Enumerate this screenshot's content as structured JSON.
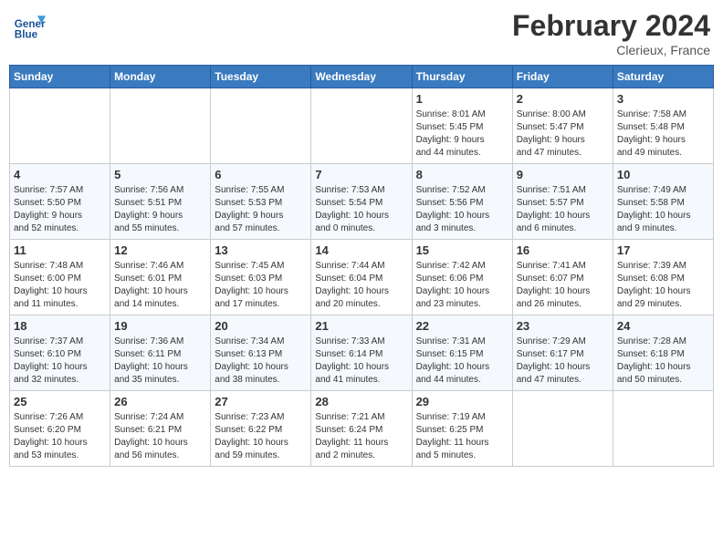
{
  "header": {
    "logo_line1": "General",
    "logo_line2": "Blue",
    "month_title": "February 2024",
    "location": "Clerieux, France"
  },
  "calendar": {
    "days_of_week": [
      "Sunday",
      "Monday",
      "Tuesday",
      "Wednesday",
      "Thursday",
      "Friday",
      "Saturday"
    ],
    "weeks": [
      [
        {
          "day": "",
          "info": ""
        },
        {
          "day": "",
          "info": ""
        },
        {
          "day": "",
          "info": ""
        },
        {
          "day": "",
          "info": ""
        },
        {
          "day": "1",
          "info": "Sunrise: 8:01 AM\nSunset: 5:45 PM\nDaylight: 9 hours\nand 44 minutes."
        },
        {
          "day": "2",
          "info": "Sunrise: 8:00 AM\nSunset: 5:47 PM\nDaylight: 9 hours\nand 47 minutes."
        },
        {
          "day": "3",
          "info": "Sunrise: 7:58 AM\nSunset: 5:48 PM\nDaylight: 9 hours\nand 49 minutes."
        }
      ],
      [
        {
          "day": "4",
          "info": "Sunrise: 7:57 AM\nSunset: 5:50 PM\nDaylight: 9 hours\nand 52 minutes."
        },
        {
          "day": "5",
          "info": "Sunrise: 7:56 AM\nSunset: 5:51 PM\nDaylight: 9 hours\nand 55 minutes."
        },
        {
          "day": "6",
          "info": "Sunrise: 7:55 AM\nSunset: 5:53 PM\nDaylight: 9 hours\nand 57 minutes."
        },
        {
          "day": "7",
          "info": "Sunrise: 7:53 AM\nSunset: 5:54 PM\nDaylight: 10 hours\nand 0 minutes."
        },
        {
          "day": "8",
          "info": "Sunrise: 7:52 AM\nSunset: 5:56 PM\nDaylight: 10 hours\nand 3 minutes."
        },
        {
          "day": "9",
          "info": "Sunrise: 7:51 AM\nSunset: 5:57 PM\nDaylight: 10 hours\nand 6 minutes."
        },
        {
          "day": "10",
          "info": "Sunrise: 7:49 AM\nSunset: 5:58 PM\nDaylight: 10 hours\nand 9 minutes."
        }
      ],
      [
        {
          "day": "11",
          "info": "Sunrise: 7:48 AM\nSunset: 6:00 PM\nDaylight: 10 hours\nand 11 minutes."
        },
        {
          "day": "12",
          "info": "Sunrise: 7:46 AM\nSunset: 6:01 PM\nDaylight: 10 hours\nand 14 minutes."
        },
        {
          "day": "13",
          "info": "Sunrise: 7:45 AM\nSunset: 6:03 PM\nDaylight: 10 hours\nand 17 minutes."
        },
        {
          "day": "14",
          "info": "Sunrise: 7:44 AM\nSunset: 6:04 PM\nDaylight: 10 hours\nand 20 minutes."
        },
        {
          "day": "15",
          "info": "Sunrise: 7:42 AM\nSunset: 6:06 PM\nDaylight: 10 hours\nand 23 minutes."
        },
        {
          "day": "16",
          "info": "Sunrise: 7:41 AM\nSunset: 6:07 PM\nDaylight: 10 hours\nand 26 minutes."
        },
        {
          "day": "17",
          "info": "Sunrise: 7:39 AM\nSunset: 6:08 PM\nDaylight: 10 hours\nand 29 minutes."
        }
      ],
      [
        {
          "day": "18",
          "info": "Sunrise: 7:37 AM\nSunset: 6:10 PM\nDaylight: 10 hours\nand 32 minutes."
        },
        {
          "day": "19",
          "info": "Sunrise: 7:36 AM\nSunset: 6:11 PM\nDaylight: 10 hours\nand 35 minutes."
        },
        {
          "day": "20",
          "info": "Sunrise: 7:34 AM\nSunset: 6:13 PM\nDaylight: 10 hours\nand 38 minutes."
        },
        {
          "day": "21",
          "info": "Sunrise: 7:33 AM\nSunset: 6:14 PM\nDaylight: 10 hours\nand 41 minutes."
        },
        {
          "day": "22",
          "info": "Sunrise: 7:31 AM\nSunset: 6:15 PM\nDaylight: 10 hours\nand 44 minutes."
        },
        {
          "day": "23",
          "info": "Sunrise: 7:29 AM\nSunset: 6:17 PM\nDaylight: 10 hours\nand 47 minutes."
        },
        {
          "day": "24",
          "info": "Sunrise: 7:28 AM\nSunset: 6:18 PM\nDaylight: 10 hours\nand 50 minutes."
        }
      ],
      [
        {
          "day": "25",
          "info": "Sunrise: 7:26 AM\nSunset: 6:20 PM\nDaylight: 10 hours\nand 53 minutes."
        },
        {
          "day": "26",
          "info": "Sunrise: 7:24 AM\nSunset: 6:21 PM\nDaylight: 10 hours\nand 56 minutes."
        },
        {
          "day": "27",
          "info": "Sunrise: 7:23 AM\nSunset: 6:22 PM\nDaylight: 10 hours\nand 59 minutes."
        },
        {
          "day": "28",
          "info": "Sunrise: 7:21 AM\nSunset: 6:24 PM\nDaylight: 11 hours\nand 2 minutes."
        },
        {
          "day": "29",
          "info": "Sunrise: 7:19 AM\nSunset: 6:25 PM\nDaylight: 11 hours\nand 5 minutes."
        },
        {
          "day": "",
          "info": ""
        },
        {
          "day": "",
          "info": ""
        }
      ]
    ]
  }
}
